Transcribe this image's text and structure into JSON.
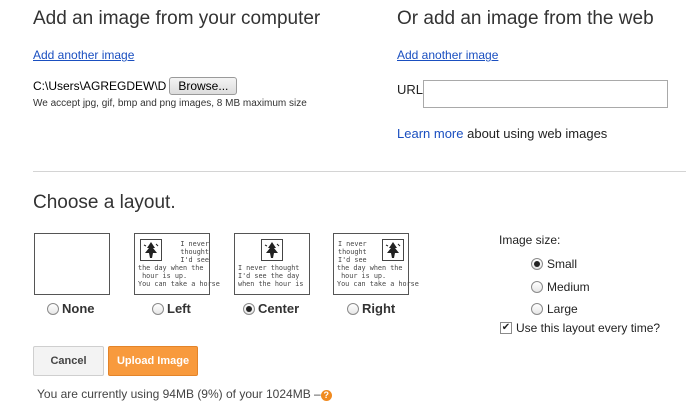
{
  "computer": {
    "heading": "Add an image from your computer",
    "add_another": "Add another image",
    "file_path": "C:\\Users\\AGREGDEW\\D",
    "browse_label": "Browse...",
    "accepted_note": "We accept jpg, gif, bmp and png images, 8 MB maximum size"
  },
  "web": {
    "heading": "Or add an image from the web",
    "add_another": "Add another image",
    "url_label": "URL",
    "url_value": "",
    "learn_more_link": "Learn more",
    "learn_more_rest": "about using web images"
  },
  "layout": {
    "heading": "Choose a layout.",
    "sample_text": "I never thought I'd see the day when the hour is up. You can take a horse",
    "options": [
      {
        "label": "None",
        "selected": false
      },
      {
        "label": "Left",
        "selected": false
      },
      {
        "label": "Center",
        "selected": true
      },
      {
        "label": "Right",
        "selected": false
      }
    ]
  },
  "image_size": {
    "label": "Image size:",
    "options": [
      {
        "label": "Small",
        "selected": true
      },
      {
        "label": "Medium",
        "selected": false
      },
      {
        "label": "Large",
        "selected": false
      }
    ],
    "use_always_label": "Use this layout every time?",
    "use_always_checked": true
  },
  "buttons": {
    "cancel": "Cancel",
    "upload": "Upload Image"
  },
  "usage": {
    "text": "You are currently using 94MB (9%) of your 1024MB",
    "dash": "–",
    "help": "?"
  }
}
